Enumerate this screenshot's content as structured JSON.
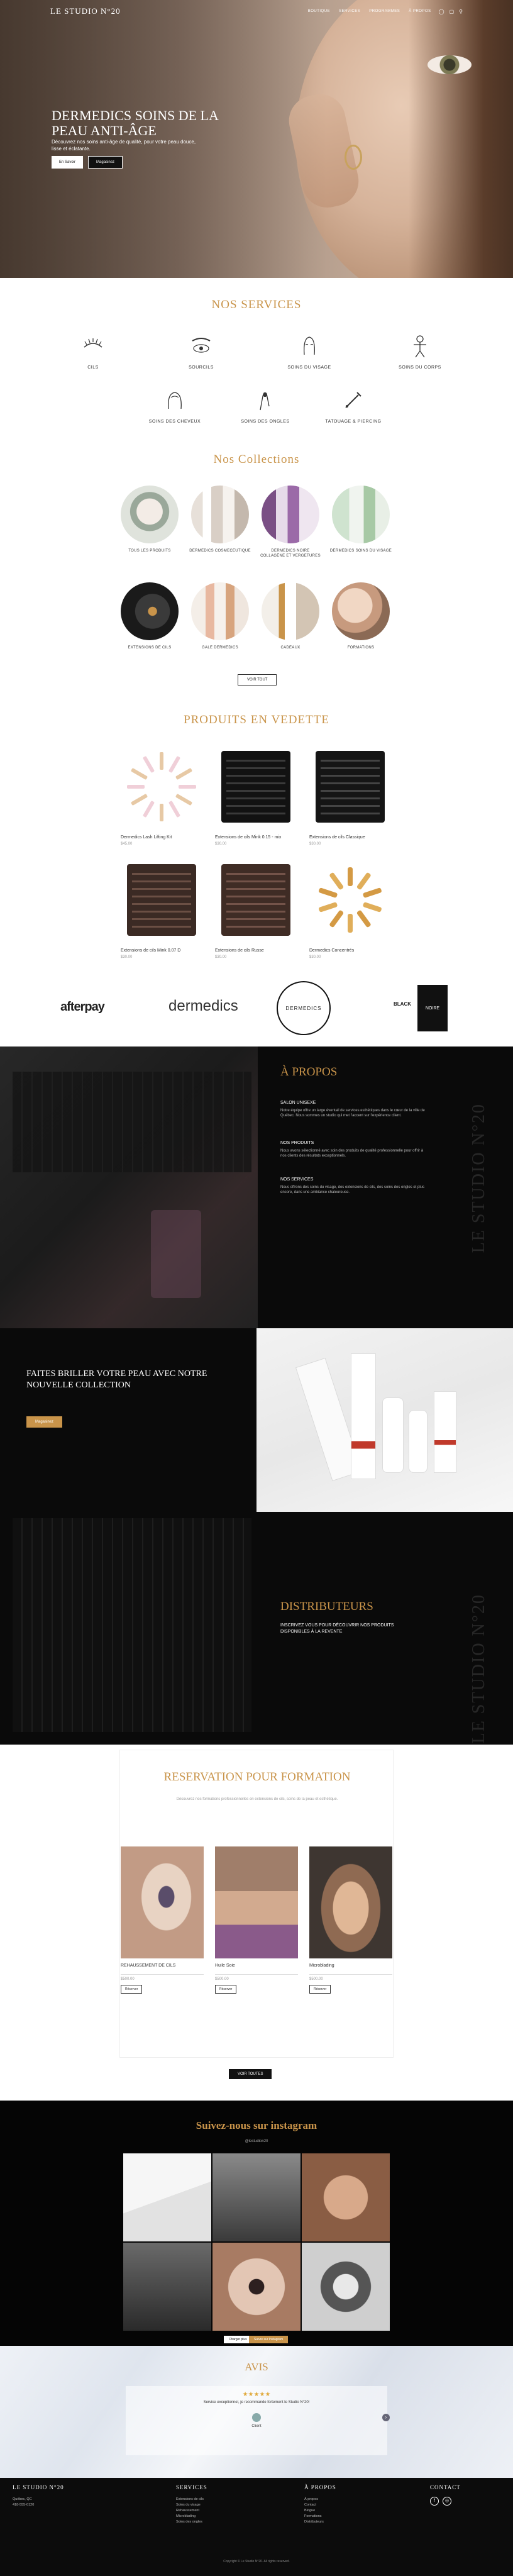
{
  "nav": {
    "brand": "LE STUDIO N°20",
    "links": [
      "BOUTIQUE",
      "SERVICES",
      "PROGRAMMES",
      "À PROPOS"
    ],
    "icons": [
      "user-icon",
      "cart-icon",
      "search-icon"
    ]
  },
  "hero": {
    "title": "DERMEDICS SOINS DE LA PEAU ANTI-ÂGE",
    "subtitle": "Découvrez nos soins anti-âge de qualité, pour votre peau douce, lisse et éclatante.",
    "btn_primary": "En Savoir",
    "btn_secondary": "Magasinez"
  },
  "services": {
    "title": "NOS SERVICES",
    "items": [
      {
        "label": "CILS",
        "icon": "eyelash-icon"
      },
      {
        "label": "SOURCILS",
        "icon": "eyebrow-icon"
      },
      {
        "label": "SOINS DU VISAGE",
        "icon": "face-icon"
      },
      {
        "label": "SOINS DU CORPS",
        "icon": "body-icon"
      },
      {
        "label": "SOINS DES CHEVEUX",
        "icon": "hair-icon"
      },
      {
        "label": "SOINS DES ONGLES",
        "icon": "nail-icon"
      },
      {
        "label": "TATOUAGE & PIERCING",
        "icon": "tattoo-icon"
      }
    ]
  },
  "collections": {
    "title": "Nos Collections",
    "items": [
      "TOUS LES PRODUITS",
      "DERMEDICS COSMECEUTIQUE",
      "DERMEDICS NOIRE COLLAGÈNE ET VERGETURES",
      "DERMEDICS SOINS DU VISAGE",
      "EXTENSIONS DE CILS",
      "GALE DERMEDICS",
      "CADEAUX",
      "FORMATIONS"
    ],
    "view_all": "VOIR TOUT"
  },
  "products": {
    "title": "PRODUITS EN VEDETTE",
    "items": [
      {
        "name": "Dermedics Lash Lifting Kit",
        "price": "$45.00"
      },
      {
        "name": "Extensions de cils Mink 0.15 - mix",
        "price": "$30.00"
      },
      {
        "name": "Extensions de cils Classique",
        "price": "$30.00"
      },
      {
        "name": "Extensions de cils Mink 0.07 D",
        "price": "$30.00"
      },
      {
        "name": "Extensions de cils Russe",
        "price": "$30.00"
      },
      {
        "name": "Dermedics Concentrés",
        "price": "$30.00"
      }
    ]
  },
  "brands": [
    "afterpay",
    "dermedics",
    "DERMEDICS",
    "BLACK",
    "NOIRE"
  ],
  "about": {
    "title": "À PROPOS",
    "blocks": [
      {
        "heading": "SALON UNISEXE",
        "text": "Notre équipe offre un large éventail de services esthétiques dans le cœur de la ville de Québec. Nous sommes un studio qui met l'accent sur l'expérience client."
      },
      {
        "heading": "NOS PRODUITS",
        "text": "Nous avons sélectionné avec soin des produits de qualité professionnelle pour offrir à nos clients des résultats exceptionnels."
      },
      {
        "heading": "NOS SERVICES",
        "text": "Nous offrons des soins du visage, des extensions de cils, des soins des ongles et plus encore, dans une ambiance chaleureuse."
      }
    ],
    "vertical": "LE STUDIO N°20"
  },
  "promo": {
    "title": "FAITES BRILLER VOTRE PEAU AVEC NOTRE NOUVELLE COLLECTION",
    "btn": "Magasinez"
  },
  "distrib": {
    "title": "DISTRIBUTEURS",
    "text": "INSCRIVEZ VOUS POUR DÉCOUVRIR NOS PRODUITS DISPONIBLES À LA REVENTE",
    "vertical": "LE STUDIO N°20"
  },
  "training": {
    "title": "RESERVATION POUR FORMATION",
    "desc": "Découvrez nos formations professionnelles en extensions de cils, soins de la peau et esthétique.",
    "items": [
      {
        "name": "REHAUSSEMENT DE CILS",
        "price": "$500.00",
        "btn": "Réserver"
      },
      {
        "name": "Huile Soie",
        "price": "$500.00",
        "btn": "Réserver"
      },
      {
        "name": "Microblading",
        "price": "$500.00",
        "btn": "Réserver"
      }
    ],
    "btn_all": "VOIR TOUTES"
  },
  "instagram": {
    "title": "Suivez-nous sur instagram",
    "handle": "@lestudion20",
    "btn_load": "Charger plus",
    "btn_follow": "Suivre sur Instagram"
  },
  "reviews": {
    "title": "AVIS",
    "text": "Service exceptionnel, je recommande fortement le Studio N°20!",
    "author": "Client"
  },
  "footer": {
    "col1_title": "LE STUDIO N°20",
    "col1_items": [
      "Québec, QC",
      "418-555-0120"
    ],
    "col2_title": "SERVICES",
    "col2_items": [
      "Extensions de cils",
      "Soins du visage",
      "Rehaussement",
      "Microblading",
      "Soins des ongles"
    ],
    "col3_title": "À PROPOS",
    "col3_items": [
      "À propos",
      "Contact",
      "Blogue",
      "Formations",
      "Distributeurs"
    ],
    "col4_title": "CONTACT",
    "copyright": "Copyright © Le Studio N°20. All rights reserved."
  }
}
